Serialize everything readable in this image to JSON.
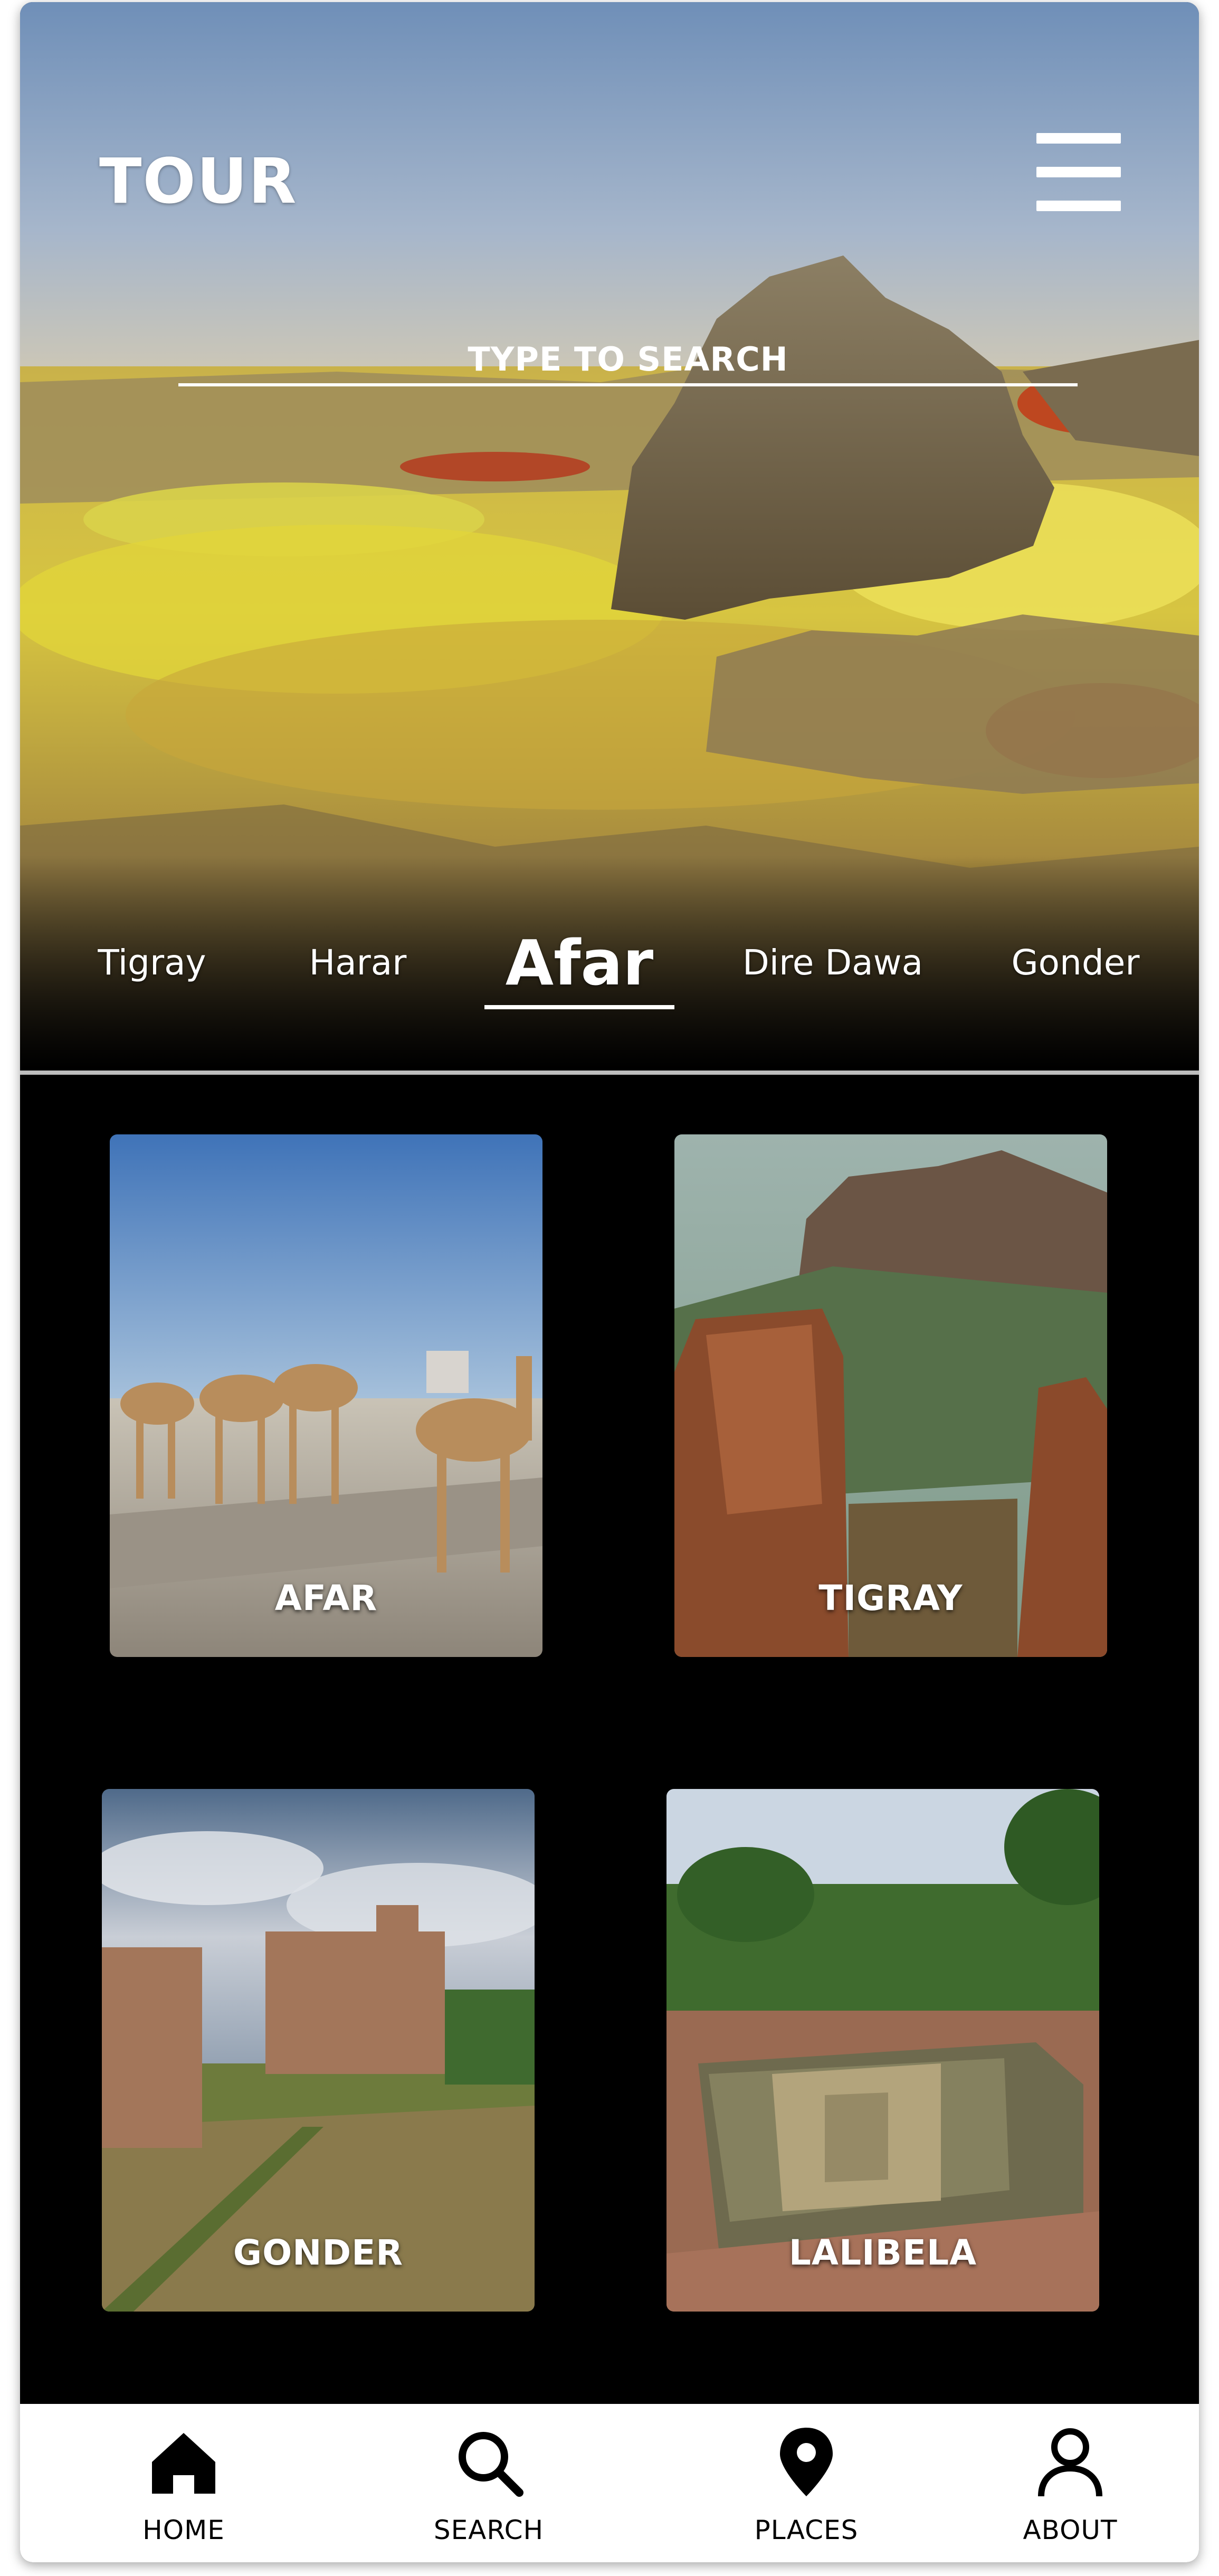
{
  "app": {
    "title": "TOUR"
  },
  "header": {
    "menu_icon": "hamburger-menu-icon"
  },
  "search": {
    "placeholder": "TYPE TO SEARCH",
    "value": ""
  },
  "regions": {
    "tabs": [
      {
        "label": "Tigray"
      },
      {
        "label": "Harar"
      },
      {
        "label": "Afar"
      },
      {
        "label": "Dire Dawa"
      },
      {
        "label": "Gonder"
      }
    ],
    "selected": "Afar"
  },
  "cards": [
    {
      "label": "AFAR"
    },
    {
      "label": "TIGRAY"
    },
    {
      "label": "GONDER"
    },
    {
      "label": "LALIBELA"
    }
  ],
  "bottom_nav": {
    "items": [
      {
        "label": "HOME",
        "icon": "home-icon"
      },
      {
        "label": "SEARCH",
        "icon": "search-icon"
      },
      {
        "label": "PLACES",
        "icon": "map-pin-icon"
      },
      {
        "label": "ABOUT",
        "icon": "user-icon"
      }
    ]
  },
  "colors": {
    "background": "#000000",
    "nav_background": "#ffffff",
    "text_on_image": "#ffffff",
    "divider": "#bdbdbd"
  }
}
